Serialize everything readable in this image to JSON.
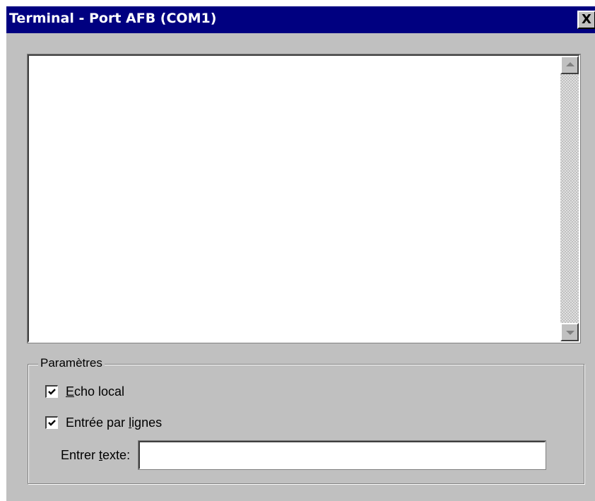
{
  "window": {
    "title": "Terminal - Port AFB (COM1)",
    "close_label": "X"
  },
  "terminal": {
    "output": ""
  },
  "parameters": {
    "group_label": "Paramètres",
    "echo_local": {
      "label_hotkey": "E",
      "label_rest": "cho local",
      "checked": true
    },
    "line_input": {
      "label_before": "Entrée par ",
      "label_hotkey": "l",
      "label_after": "ignes",
      "checked": true
    },
    "enter_text": {
      "label_before": "Entrer ",
      "label_hotkey": "t",
      "label_after": "exte:",
      "value": ""
    }
  },
  "icons": {
    "scroll_up": "scroll-up-arrow-icon",
    "scroll_down": "scroll-down-arrow-icon",
    "checkmark": "checkmark-icon",
    "close": "close-icon"
  },
  "colors": {
    "titlebar": "#000080",
    "face": "#c0c0c0"
  }
}
